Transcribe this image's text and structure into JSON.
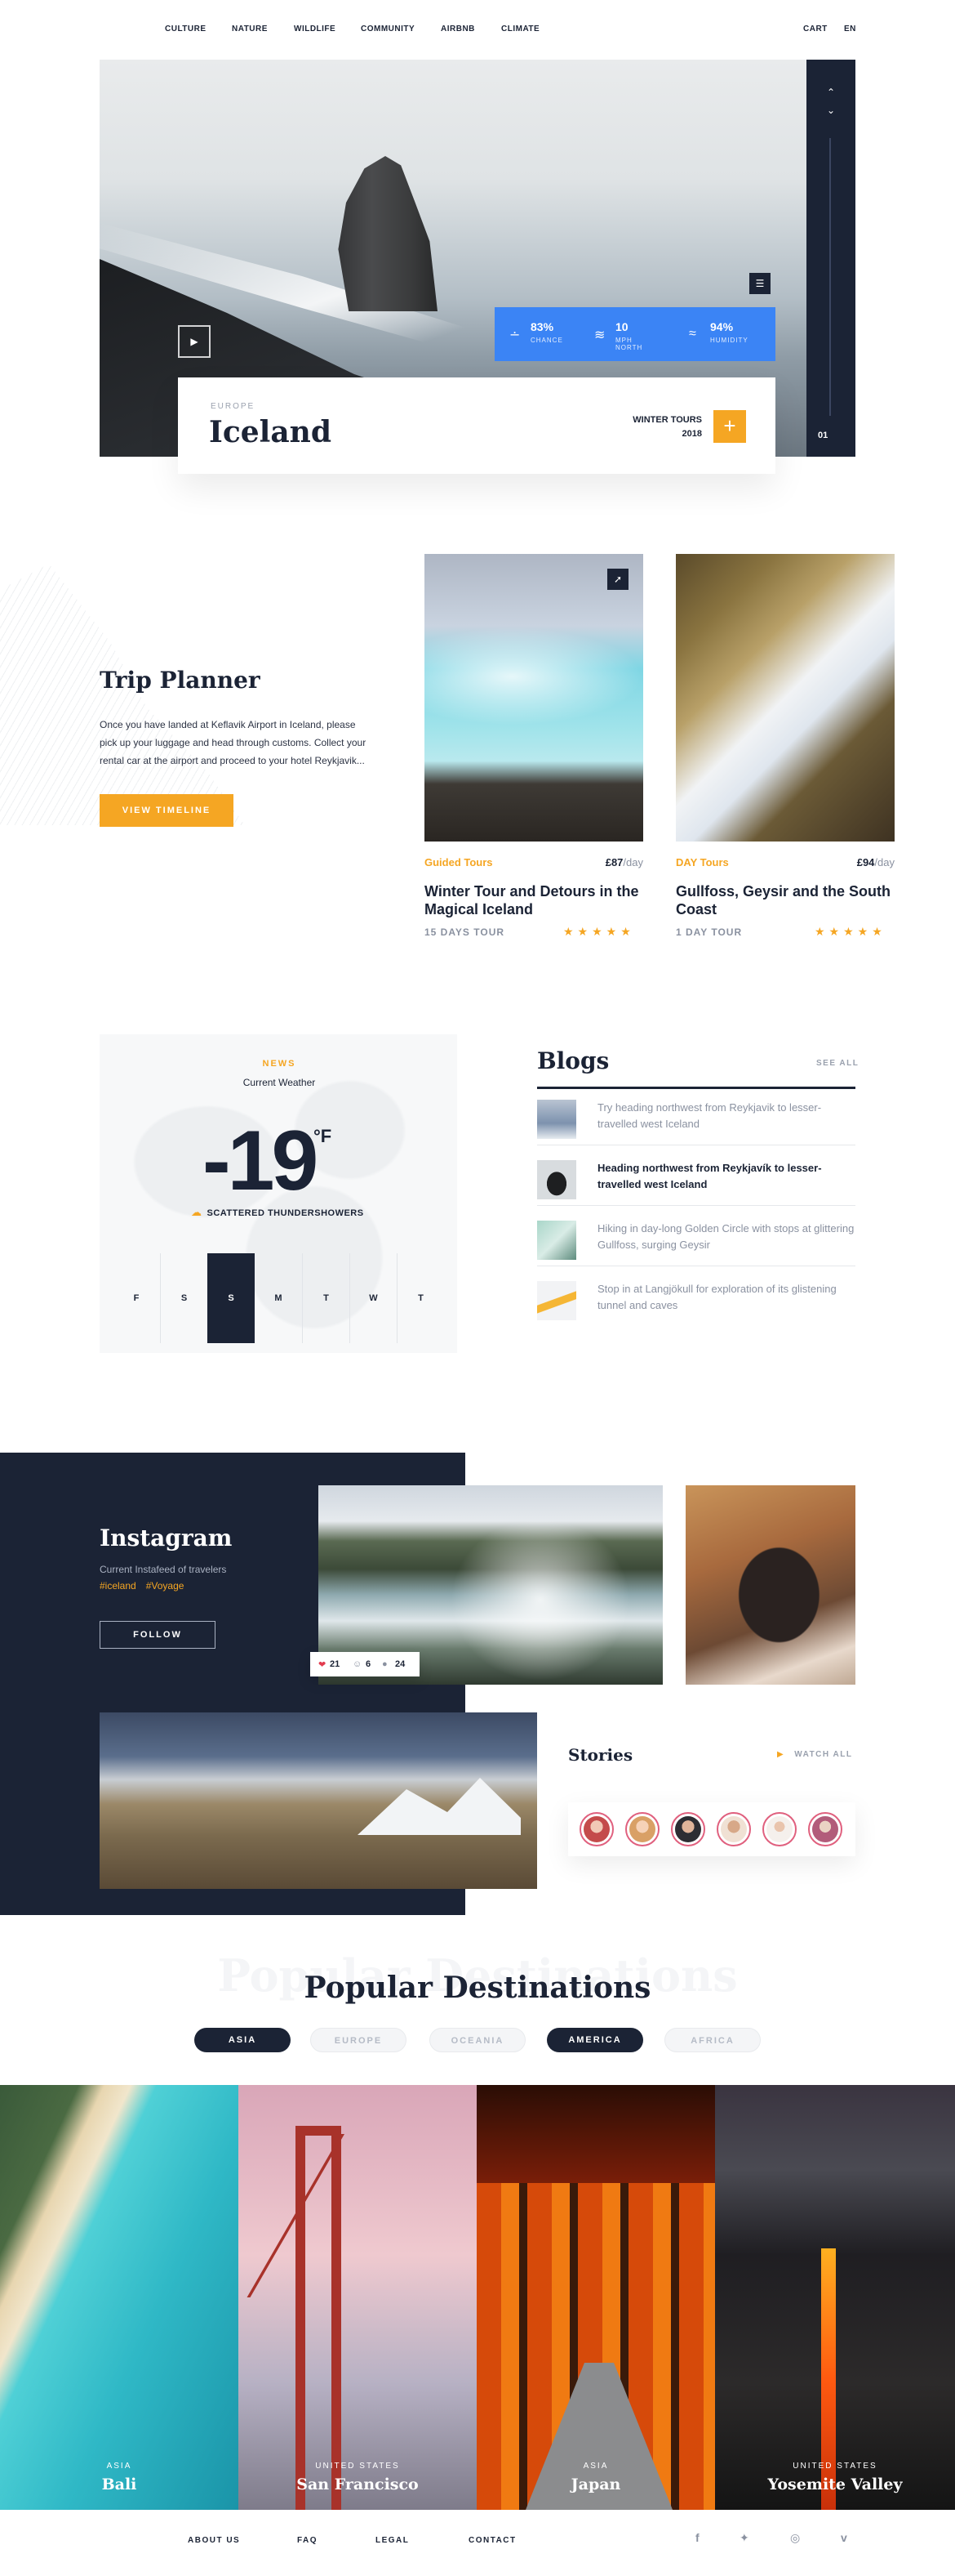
{
  "nav": {
    "items": [
      "CULTURE",
      "NATURE",
      "WILDLIFE",
      "COMMUNITY",
      "AIRBNB",
      "CLIMATE"
    ],
    "cart": "CART",
    "lang": "EN"
  },
  "hero": {
    "region": "EUROPE",
    "title": "Iceland",
    "tours_line1": "WINTER TOURS",
    "tours_line2": "2018",
    "slide": "01",
    "weather": [
      {
        "icon": "rain-drops-icon",
        "value": "83%",
        "label": "CHANCE"
      },
      {
        "icon": "wind-icon",
        "value": "10",
        "label": "MPH NORTH"
      },
      {
        "icon": "waves-icon",
        "value": "94%",
        "label": "HUMIDITY"
      }
    ]
  },
  "trip_planner": {
    "title": "Trip Planner",
    "text": "Once you have landed at Keflavik Airport in Iceland, please pick up your luggage and head through customs. Collect your rental car at the airport and proceed to your hotel Reykjavik...",
    "button": "VIEW TIMELINE"
  },
  "tours": [
    {
      "category": "Guided Tours",
      "price": "£87",
      "per": "/day",
      "name": "Winter Tour and Detours in the Magical Iceland",
      "duration": "15 DAYS TOUR",
      "stars": "★★★★★"
    },
    {
      "category": "DAY Tours",
      "price": "£94",
      "per": "/day",
      "name": "Gullfoss, Geysir and the South Coast",
      "duration": "1 DAY TOUR",
      "stars": "★★★★★"
    }
  ],
  "weather_widget": {
    "news": "NEWS",
    "current": "Current Weather",
    "temp": "-19",
    "unit": "°F",
    "condition": "SCATTERED THUNDERSHOWERS",
    "days": [
      "F",
      "S",
      "S",
      "M",
      "T",
      "W",
      "T"
    ],
    "active_day_index": 2
  },
  "blogs": {
    "title": "Blogs",
    "see_all": "SEE ALL",
    "items": [
      "Try heading northwest from Reykjavik to lesser-travelled west Iceland",
      "Heading northwest from Reykjavík to lesser-travelled west Iceland",
      "Hiking in day-long Golden Circle with stops at glittering Gullfoss, surging Geysir",
      "Stop in at Langjökull for exploration of its glistening tunnel and caves"
    ],
    "active_index": 1
  },
  "instagram": {
    "title": "Instagram",
    "subtitle": "Current Instafeed of travelers",
    "tags": [
      "#iceland",
      "#Voyage"
    ],
    "follow": "FOLLOW",
    "stats": {
      "likes": "21",
      "users": "6",
      "comments": "24"
    }
  },
  "stories": {
    "title": "Stories",
    "watch_all": "WATCH ALL"
  },
  "popular": {
    "ghost": "Popular Destinations",
    "title": "Popular Destinations",
    "filters": [
      {
        "label": "ASIA",
        "active": true
      },
      {
        "label": "EUROPE",
        "active": false
      },
      {
        "label": "OCEANIA",
        "active": false
      },
      {
        "label": "AMERICA",
        "active": true
      },
      {
        "label": "AFRICA",
        "active": false
      }
    ],
    "destinations": [
      {
        "region": "ASIA",
        "name": "Bali"
      },
      {
        "region": "UNITED STATES",
        "name": "San Francisco"
      },
      {
        "region": "ASIA",
        "name": "Japan"
      },
      {
        "region": "UNITED STATES",
        "name": "Yosemite Valley"
      }
    ]
  },
  "footer": {
    "links": [
      "ABOUT US",
      "FAQ",
      "LEGAL",
      "CONTACT"
    ],
    "social": [
      "facebook-icon",
      "twitter-icon",
      "instagram-icon",
      "vimeo-icon"
    ]
  },
  "colors": {
    "navy": "#1b2335",
    "accent": "#f5a623",
    "blue": "#3b84f5"
  }
}
